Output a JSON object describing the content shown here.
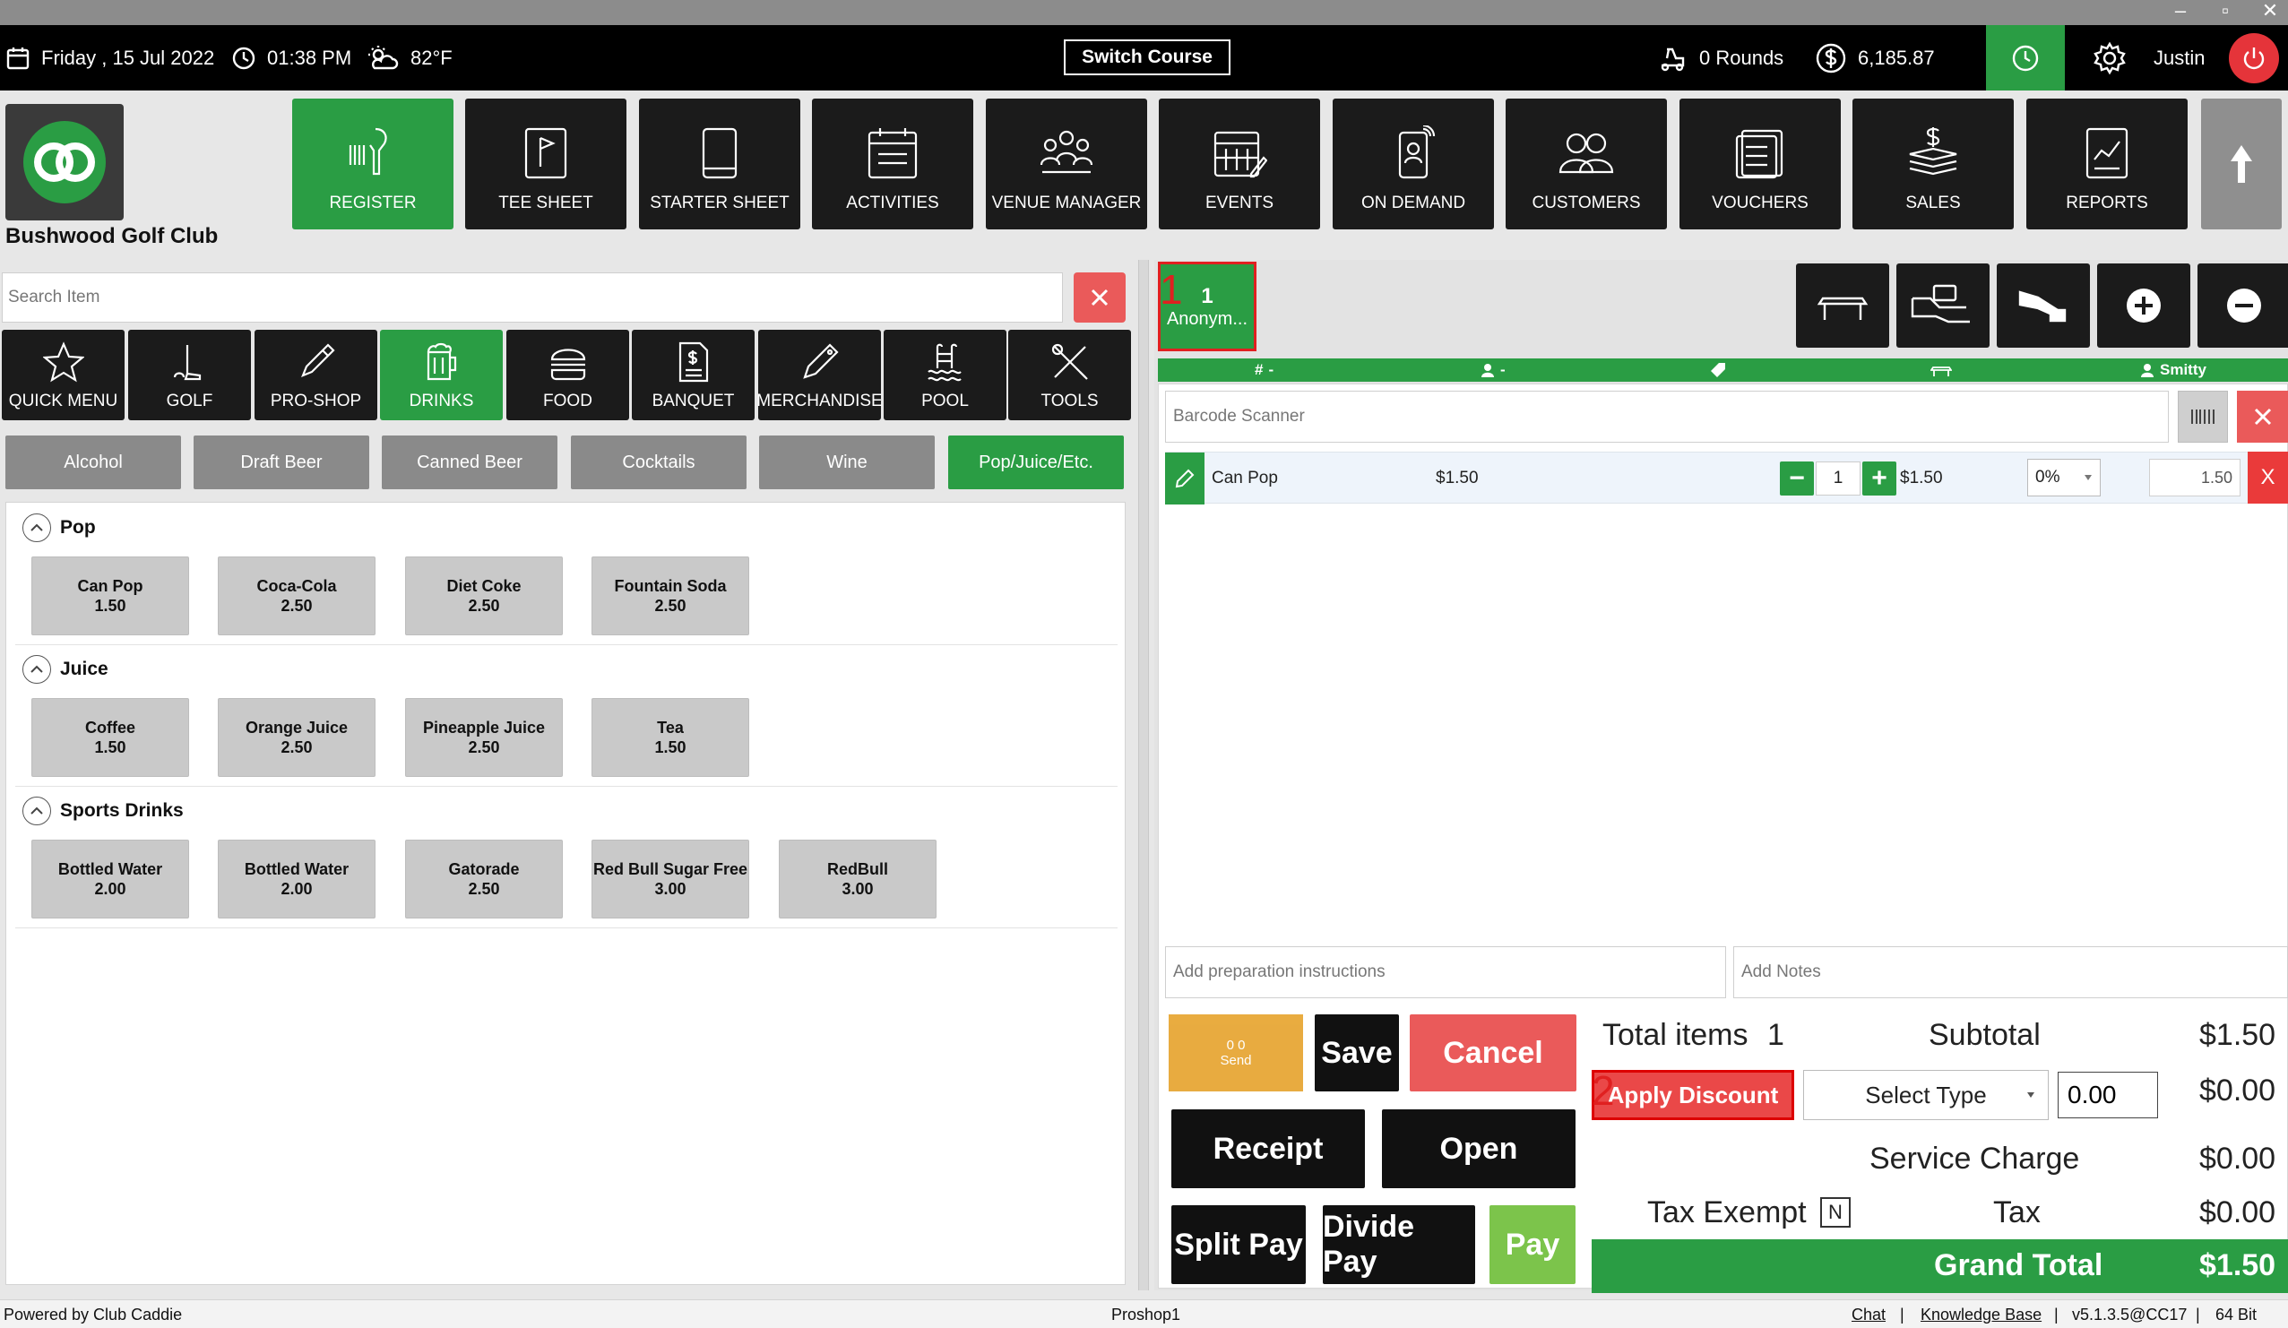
{
  "window": {
    "minimize": "–",
    "maximize": "▫",
    "close": "✕"
  },
  "topbar": {
    "date": "Friday ,  15 Jul 2022",
    "time": "01:38 PM",
    "weather": "82°F",
    "switch_course": "Switch Course",
    "rounds": "0 Rounds",
    "balance": "6,185.87",
    "user": "Justin"
  },
  "club": {
    "name": "Bushwood Golf Club"
  },
  "nav": [
    {
      "label": "REGISTER",
      "icon": "barcode-scanner-icon",
      "active": true
    },
    {
      "label": "TEE SHEET",
      "icon": "flag-sheet-icon",
      "active": false
    },
    {
      "label": "STARTER SHEET",
      "icon": "tablet-icon",
      "active": false
    },
    {
      "label": "ACTIVITIES",
      "icon": "calendar-list-icon",
      "active": false
    },
    {
      "label": "VENUE MANAGER",
      "icon": "meeting-people-icon",
      "active": false
    },
    {
      "label": "EVENTS",
      "icon": "event-calendar-icon",
      "active": false
    },
    {
      "label": "ON DEMAND",
      "icon": "mobile-order-icon",
      "active": false
    },
    {
      "label": "CUSTOMERS",
      "icon": "customers-icon",
      "active": false
    },
    {
      "label": "VOUCHERS",
      "icon": "voucher-icon",
      "active": false
    },
    {
      "label": "SALES",
      "icon": "money-stack-icon",
      "active": false
    },
    {
      "label": "REPORTS",
      "icon": "report-chart-icon",
      "active": false
    }
  ],
  "search": {
    "placeholder": "Search Item"
  },
  "categories": [
    {
      "label": "QUICK MENU",
      "icon": "star-icon",
      "active": false
    },
    {
      "label": "GOLF",
      "icon": "golf-club-icon",
      "active": false
    },
    {
      "label": "PRO-SHOP",
      "icon": "pro-shop-icon",
      "active": false
    },
    {
      "label": "DRINKS",
      "icon": "beer-mug-icon",
      "active": true
    },
    {
      "label": "FOOD",
      "icon": "burger-icon",
      "active": false
    },
    {
      "label": "BANQUET",
      "icon": "menu-doc-icon",
      "active": false
    },
    {
      "label": "MERCHANDISE",
      "icon": "merch-tag-icon",
      "active": false
    },
    {
      "label": "POOL",
      "icon": "pool-icon",
      "active": false
    },
    {
      "label": "TOOLS",
      "icon": "tools-icon",
      "active": false
    }
  ],
  "subcategories": [
    {
      "label": "Alcohol",
      "active": false
    },
    {
      "label": "Draft Beer",
      "active": false
    },
    {
      "label": "Canned Beer",
      "active": false
    },
    {
      "label": "Cocktails",
      "active": false
    },
    {
      "label": "Wine",
      "active": false
    },
    {
      "label": "Pop/Juice/Etc.",
      "active": true
    }
  ],
  "groups": [
    {
      "title": "Pop",
      "items": [
        {
          "name": "Can Pop",
          "price": "1.50"
        },
        {
          "name": "Coca-Cola",
          "price": "2.50"
        },
        {
          "name": "Diet Coke",
          "price": "2.50"
        },
        {
          "name": "Fountain Soda",
          "price": "2.50"
        }
      ]
    },
    {
      "title": "Juice",
      "items": [
        {
          "name": "Coffee",
          "price": "1.50"
        },
        {
          "name": "Orange Juice",
          "price": "2.50"
        },
        {
          "name": "Pineapple Juice",
          "price": "2.50"
        },
        {
          "name": "Tea",
          "price": "1.50"
        }
      ]
    },
    {
      "title": "Sports Drinks",
      "items": [
        {
          "name": "Bottled Water",
          "price": "2.00"
        },
        {
          "name": "Bottled Water",
          "price": "2.00"
        },
        {
          "name": "Gatorade",
          "price": "2.50"
        },
        {
          "name": "Red Bull Sugar Free",
          "price": "3.00"
        },
        {
          "name": "RedBull",
          "price": "3.00"
        }
      ]
    }
  ],
  "customer_tab": {
    "number": "1",
    "name": "Anonym...",
    "step": "1"
  },
  "order_strip": {
    "table": "-",
    "guest": "-",
    "staff": "Smitty"
  },
  "barcode": {
    "placeholder": "Barcode Scanner"
  },
  "order_line": {
    "name": "Can Pop",
    "unit_price": "$1.50",
    "qty": "1",
    "price": "$1.50",
    "discount": "0%",
    "total": "1.50",
    "remove": "X"
  },
  "prep": {
    "placeholder": "Add preparation instructions"
  },
  "notes": {
    "placeholder": "Add Notes"
  },
  "actions": {
    "send_counts": "0   0",
    "send": "Send",
    "save": "Save",
    "cancel": "Cancel",
    "receipt": "Receipt",
    "open": "Open",
    "split_pay": "Split Pay",
    "divide_pay": "Divide Pay",
    "pay": "Pay"
  },
  "totals": {
    "total_items_label": "Total items",
    "total_items": "1",
    "subtotal_label": "Subtotal",
    "subtotal": "$1.50",
    "apply_discount": "Apply Discount",
    "discount_step": "2",
    "select_type": "Select Type",
    "discount_value": "0.00",
    "discount_total": "$0.00",
    "service_charge_label": "Service Charge",
    "service_charge": "$0.00",
    "tax_exempt_label": "Tax Exempt",
    "tax_exempt_value": "N",
    "tax_label": "Tax",
    "tax": "$0.00",
    "grand_total_label": "Grand Total",
    "grand_total": "$1.50"
  },
  "footer": {
    "powered_by": "Powered by Club Caddie",
    "terminal": "Proshop1",
    "chat": "Chat",
    "knowledge_base": "Knowledge Base",
    "version": "v5.1.3.5@CC17",
    "bits": "64 Bit",
    "sep": "|"
  },
  "colors": {
    "accent_green": "#2a9d44",
    "danger_red": "#ea5a5a",
    "dark_tile": "#1b1b1b",
    "send_orange": "#e59d1f"
  }
}
